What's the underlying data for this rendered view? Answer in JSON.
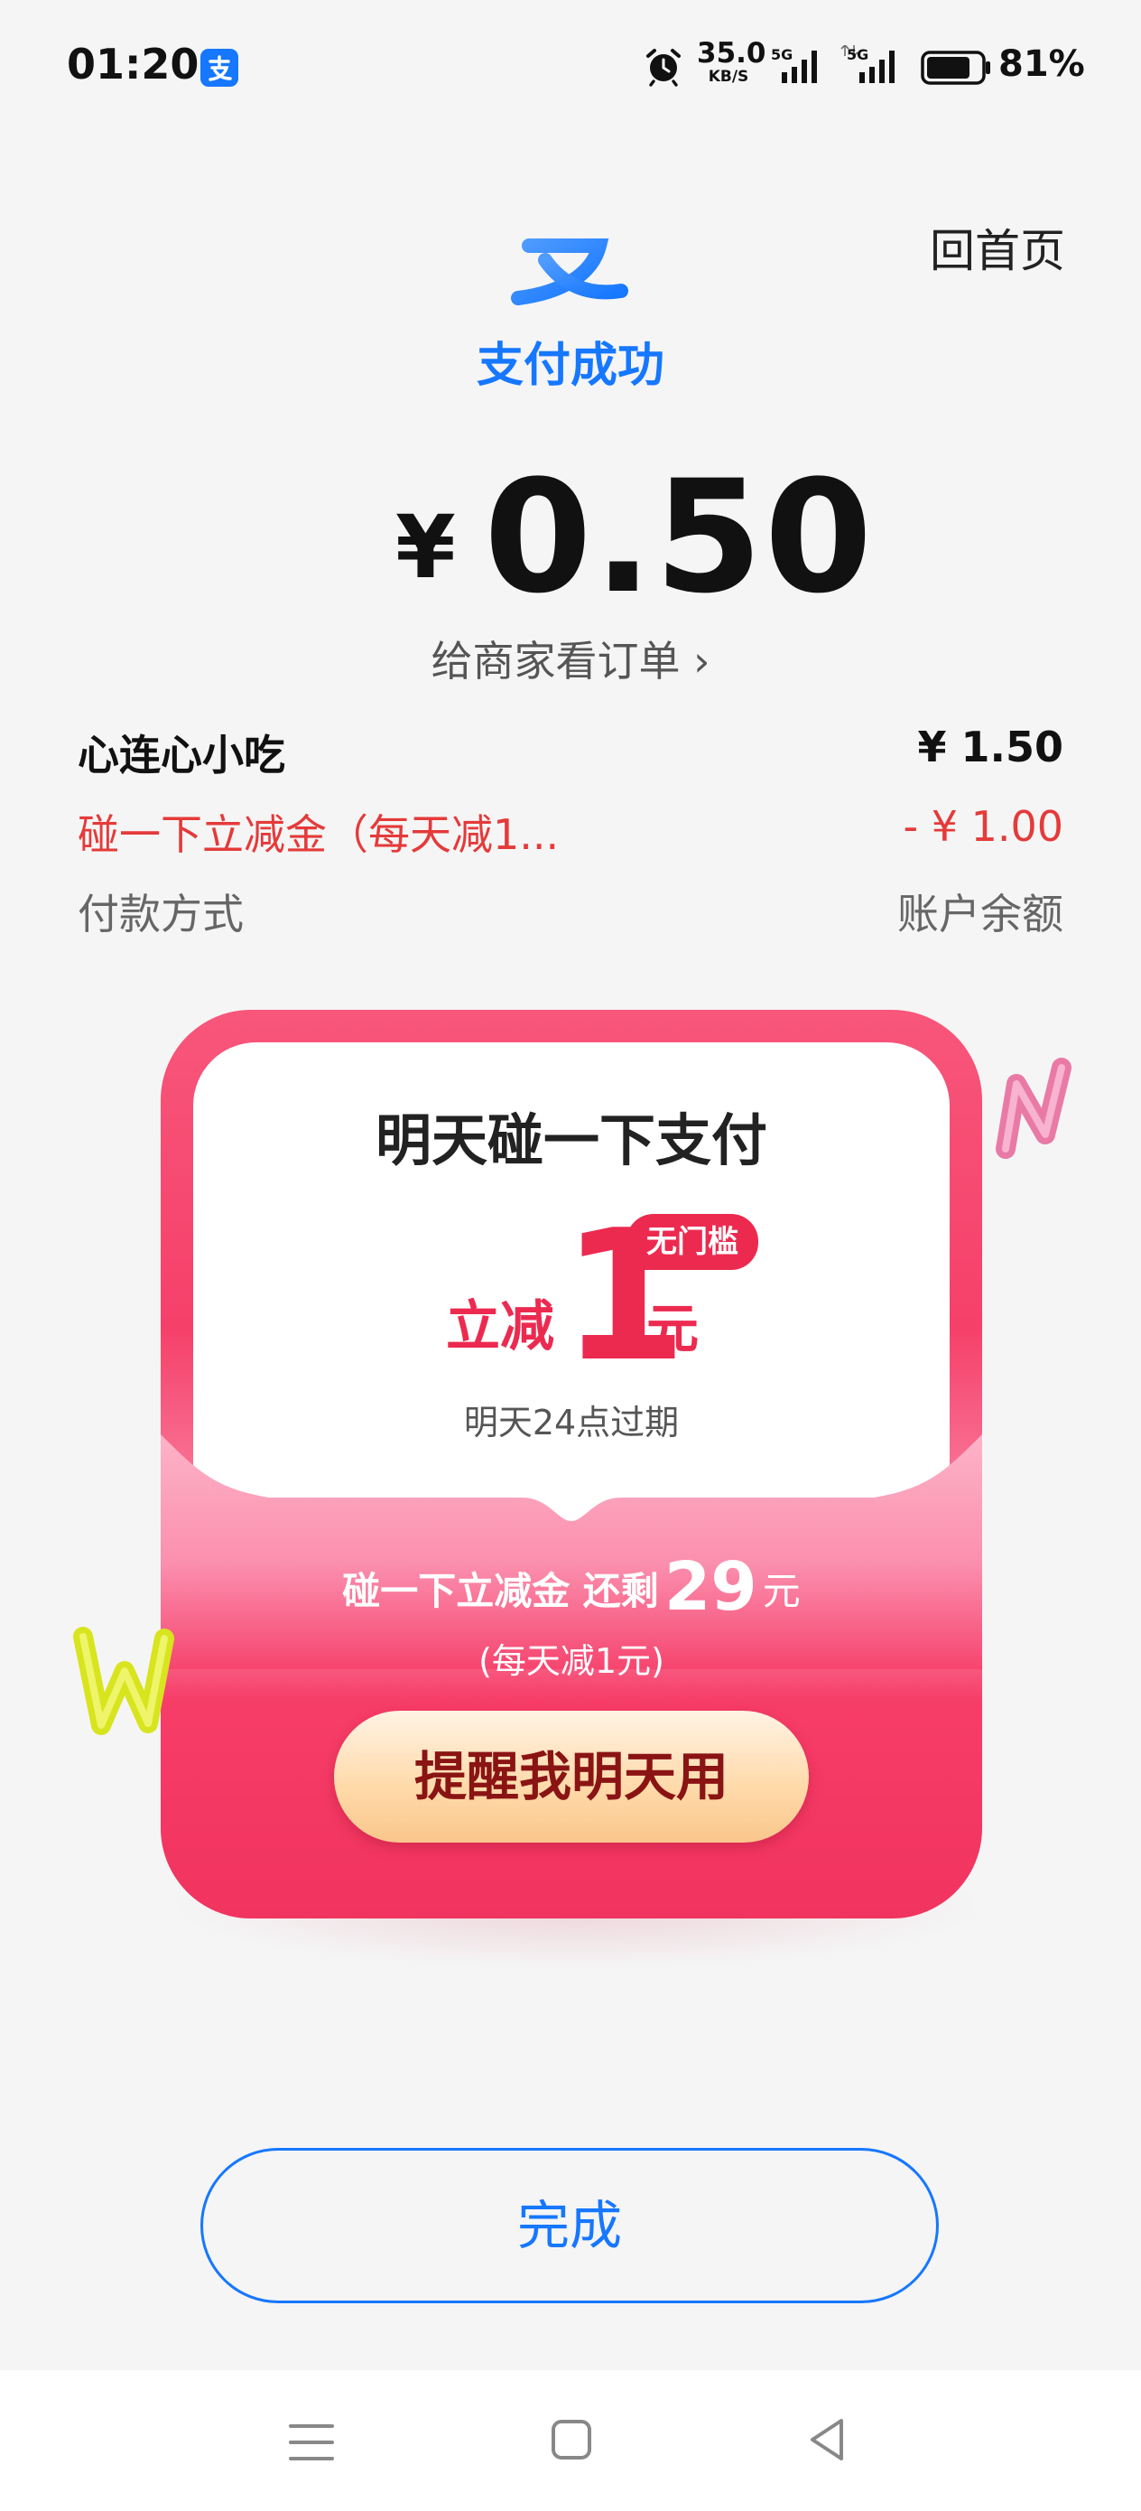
{
  "status_bar": {
    "time": "01:20",
    "app_icon": "alipay-icon",
    "net_speed_value": "35.0",
    "net_speed_unit": "KB/S",
    "sim1_label": "5G",
    "sim2_label": "5G",
    "battery_text": "81%",
    "battery_level": 0.81
  },
  "header": {
    "logo_icon": "alipay-logo-icon",
    "status_text": "支付成功",
    "home_link": "回首页"
  },
  "payment": {
    "currency_symbol": "¥",
    "amount": "0.50",
    "show_order_label": "给商家看订单",
    "show_order_chevron": "›"
  },
  "details": {
    "merchant_name": "心连心小吃",
    "merchant_amount": "¥ 1.50",
    "discount_name": "碰一下立减金（每天减1...",
    "discount_amount": "- ¥ 1.00",
    "method_label": "付款方式",
    "method_value": "账户余额"
  },
  "promo": {
    "title": "明天碰一下支付",
    "reduce_label": "立减",
    "reduce_amount": "1",
    "reduce_unit": "元",
    "badge": "无门槛",
    "expire_text": "明天24点过期",
    "remaining_prefix": "碰一下立减金 还剩",
    "remaining_amount": "29",
    "remaining_unit": "元",
    "note": "(每天减1元)",
    "button_label": "提醒我明天用"
  },
  "done_button": "完成",
  "nav_bar": {
    "menu_icon": "menu-icon",
    "home_icon": "home-square-icon",
    "back_icon": "back-triangle-icon"
  },
  "colors": {
    "accent_blue": "#1677ff",
    "discount_red": "#e53a3a",
    "promo_pink": "#f5406a",
    "promo_red": "#ec2a50"
  }
}
